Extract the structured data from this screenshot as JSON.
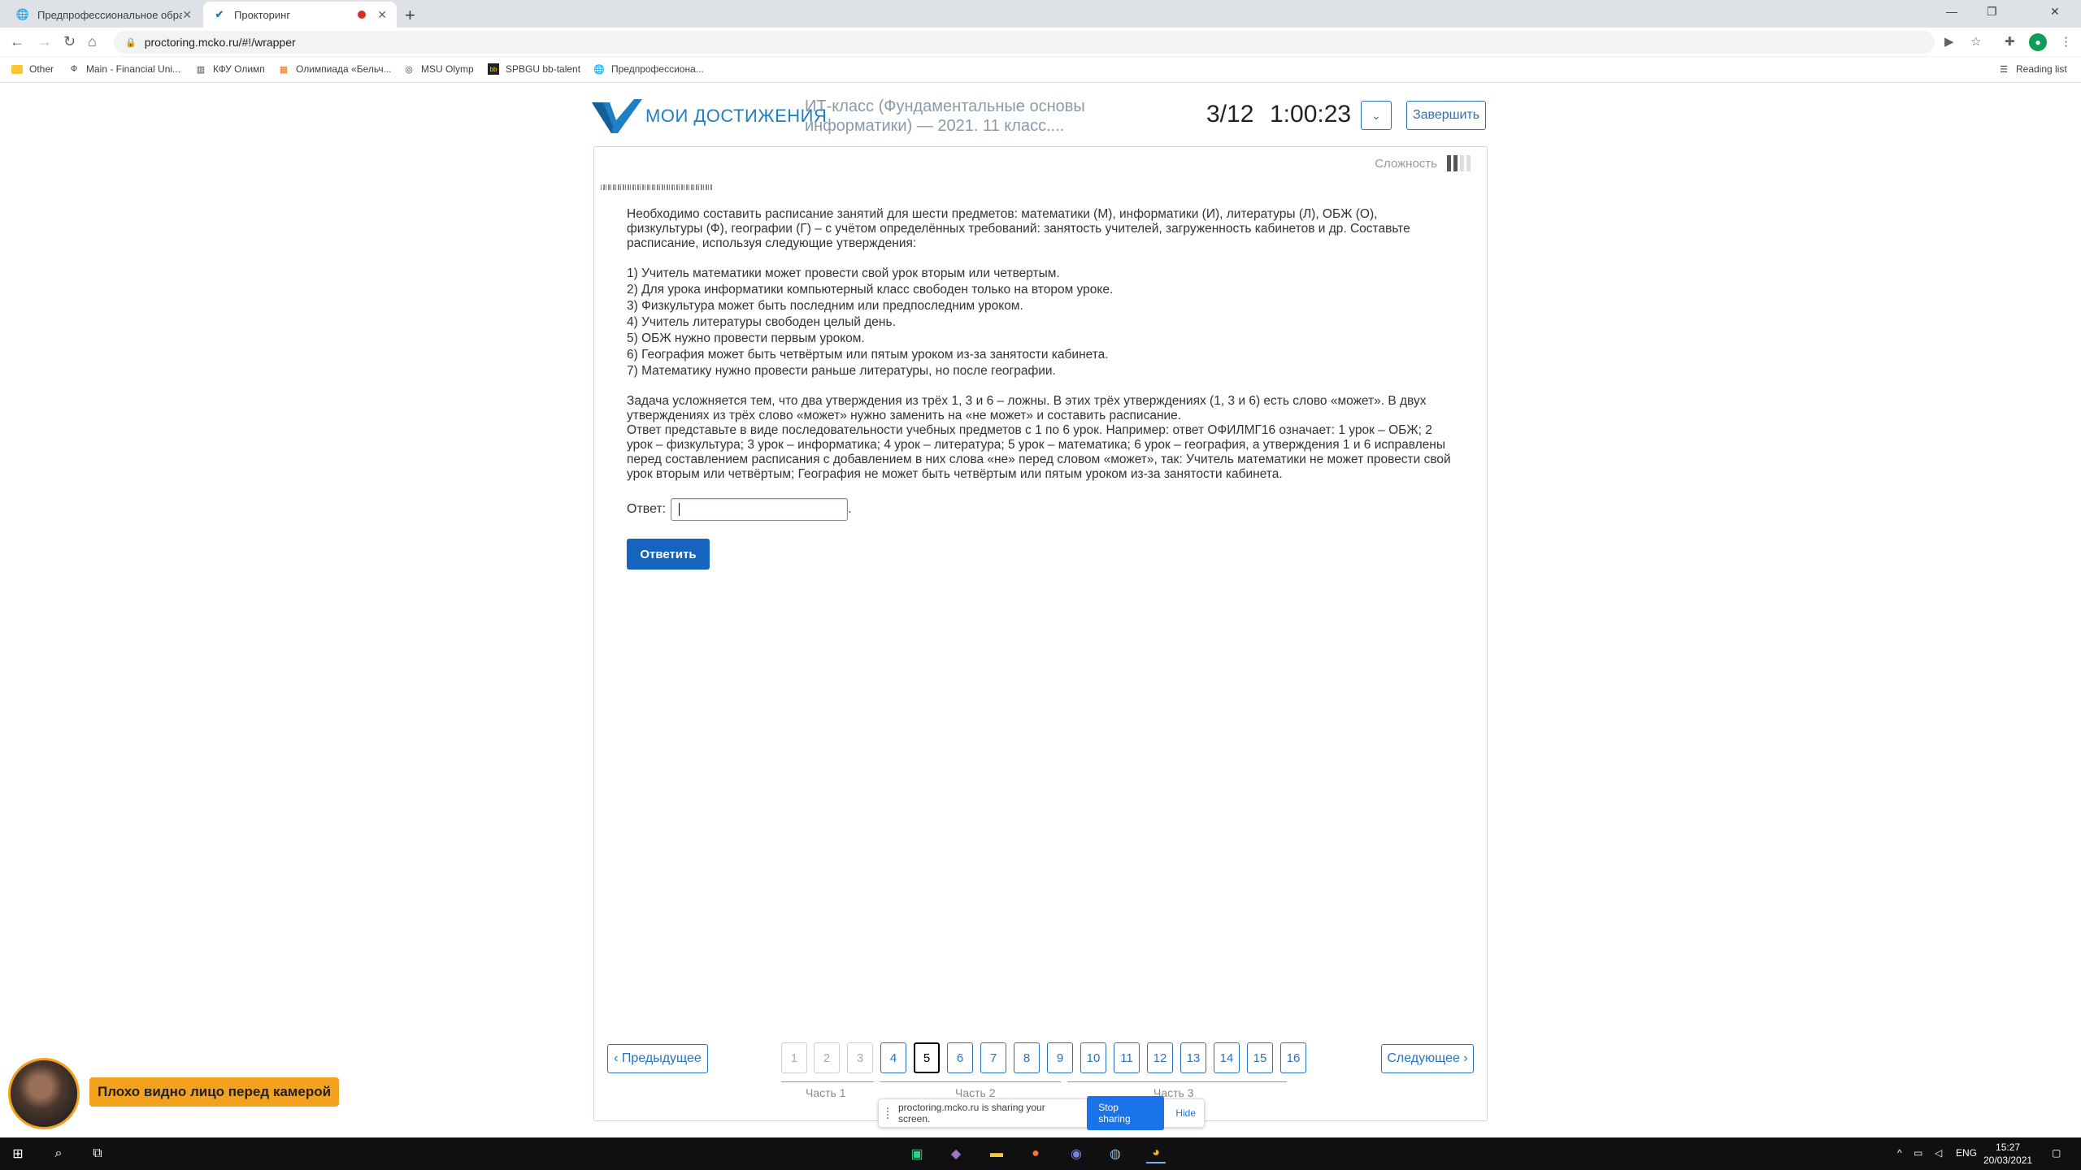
{
  "browser": {
    "tabs": [
      {
        "title": "Предпрофессиональное образ...",
        "active": false
      },
      {
        "title": "Прокторинг",
        "active": true
      }
    ],
    "url": "proctoring.mcko.ru/#!/wrapper",
    "bookmarks": [
      "Other",
      "Main - Financial Uni...",
      "КФУ Олимп",
      "Олимпиада «Бельч...",
      "MSU Olymp",
      "SPBGU bb-talent",
      "Предпрофессиона..."
    ],
    "reading_list": "Reading list"
  },
  "header": {
    "logo_text": "МОИ ДОСТИЖЕНИЯ",
    "course_title": "ИТ-класс (Фундаментальные основы информатики) — 2021. 11 класс....",
    "counter": "3/12",
    "timer": "1:00:23",
    "finish_label": "Завершить"
  },
  "task": {
    "difficulty_label": "Сложность",
    "intro": "Необходимо составить расписание занятий для шести предметов: математики (М), информатики (И), литературы (Л), ОБЖ (О), физкультуры (Ф), географии (Г) – с учётом определённых требований: занятость учителей, загруженность кабинетов и др. Составьте расписание, используя следующие утверждения:",
    "statements": [
      "1) Учитель математики может провести свой урок вторым или четвертым.",
      "2) Для урока информатики компьютерный класс свободен только на втором уроке.",
      "3) Физкультура может быть последним или предпоследним уроком.",
      "4) Учитель литературы свободен целый день.",
      "5) ОБЖ нужно провести первым уроком.",
      "6) География может быть четвёртым или пятым уроком из-за занятости кабинета.",
      "7) Математику нужно провести раньше литературы, но после географии."
    ],
    "complication": "Задача усложняется тем, что два утверждения из трёх 1, 3 и 6 – ложны. В этих трёх утверждениях (1, 3 и 6) есть слово «может». В двух утверждениях из трёх слово «может» нужно заменить на «не может» и составить расписание.",
    "format": "Ответ представьте в виде последовательности учебных предметов с 1 по 6 урок. Например: ответ ОФИЛМГ16 означает: 1 урок – ОБЖ; 2 урок – физкультура; 3 урок – информатика; 4 урок – литература; 5 урок – математика; 6 урок – география, а утверждения 1 и 6 исправлены перед составлением расписания с добавлением в них слова «не» перед словом «может», так: Учитель математики не может провести свой урок вторым или четвёртым; География не может быть четвёртым или пятым уроком из-за занятости кабинета.",
    "answer_label": "Ответ:",
    "answer_value": "",
    "submit_label": "Ответить"
  },
  "nav": {
    "prev_label": "‹ Предыдущее",
    "next_label": "Следующее ›",
    "pages": [
      "1",
      "2",
      "3",
      "4",
      "5",
      "6",
      "7",
      "8",
      "9",
      "10",
      "11",
      "12",
      "13",
      "14",
      "15",
      "16"
    ],
    "current_page": "5",
    "parts": [
      "Часть 1",
      "Часть 2",
      "Часть 3"
    ]
  },
  "share": {
    "text": "proctoring.mcko.ru is sharing your screen.",
    "stop_label": "Stop sharing",
    "hide_label": "Hide"
  },
  "proctor": {
    "warning": "Плохо видно лицо перед камерой"
  },
  "taskbar": {
    "lang": "ENG",
    "time": "15:27",
    "date": "20/03/2021"
  },
  "colors": {
    "brand": "#1f7fc3",
    "primary_button": "#1565c0",
    "warning": "#f4a11d"
  }
}
